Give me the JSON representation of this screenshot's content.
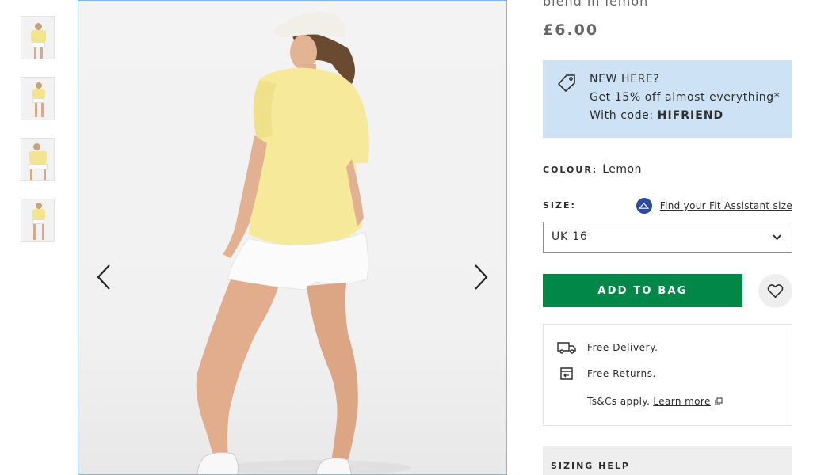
{
  "product": {
    "title": "blend in lemon",
    "price": "£6.00",
    "colour_label": "COLOUR:",
    "colour_value": "Lemon",
    "size_label": "SIZE:",
    "fit_link": "Find your Fit Assistant size",
    "selected_size": "UK 16",
    "add_to_bag": "ADD TO BAG"
  },
  "promo": {
    "line1": "NEW HERE?",
    "line2": "Get 15% off almost everything*",
    "line3_prefix": "With code: ",
    "code": "HIFRIEND"
  },
  "delivery": {
    "free_delivery": "Free Delivery.",
    "free_returns": "Free Returns.",
    "terms_prefix": "Ts&Cs apply.",
    "learn_more": "Learn more"
  },
  "sizing_help": "SIZING HELP",
  "thumbnails": [
    {
      "icon": "product-thumbnail"
    },
    {
      "icon": "product-thumbnail"
    },
    {
      "icon": "product-thumbnail"
    },
    {
      "icon": "product-thumbnail"
    }
  ],
  "colors": {
    "add_to_bag_bg": "#018849",
    "promo_bg": "#cde3f5",
    "image_border": "#80b3e8"
  }
}
